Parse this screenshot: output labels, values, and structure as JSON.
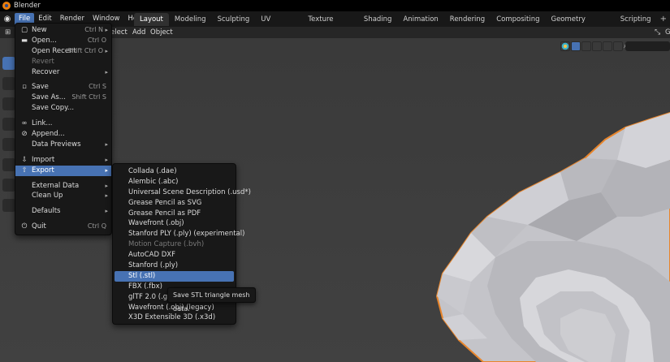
{
  "app": {
    "title": "Blender"
  },
  "topbar": {
    "menus": [
      "File",
      "Edit",
      "Render",
      "Window",
      "Help"
    ],
    "workspaces": [
      "Layout",
      "Modeling",
      "Sculpting",
      "UV Editing",
      "Texture Paint",
      "Shading",
      "Animation",
      "Rendering",
      "Compositing",
      "Geometry Nodes",
      "Scripting"
    ],
    "add_tab": "+"
  },
  "viewport_header": {
    "select_partial": "elect",
    "add": "Add",
    "object": "Object",
    "right_g": "G"
  },
  "file_menu": {
    "items": [
      {
        "label": "New",
        "shortcut": "Ctrl N",
        "icon": "document-icon",
        "glyph": "▢",
        "submenu": true
      },
      {
        "label": "Open...",
        "shortcut": "Ctrl O",
        "icon": "folder-icon",
        "glyph": "▬"
      },
      {
        "label": "Open Recent",
        "shortcut": "Shift Ctrl O",
        "submenu": true
      },
      {
        "label": "Revert",
        "disabled": true
      },
      {
        "label": "Recover",
        "submenu": true
      },
      {
        "sep": true
      },
      {
        "label": "Save",
        "shortcut": "Ctrl S",
        "icon": "save-icon",
        "glyph": "▫"
      },
      {
        "label": "Save As...",
        "shortcut": "Shift Ctrl S"
      },
      {
        "label": "Save Copy..."
      },
      {
        "sep": true
      },
      {
        "label": "Link...",
        "icon": "link-icon",
        "glyph": "∞"
      },
      {
        "label": "Append...",
        "icon": "append-icon",
        "glyph": "⊘"
      },
      {
        "label": "Data Previews",
        "submenu": true
      },
      {
        "sep": true
      },
      {
        "label": "Import",
        "icon": "import-icon",
        "glyph": "⇩",
        "submenu": true
      },
      {
        "label": "Export",
        "icon": "export-icon",
        "glyph": "⇧",
        "submenu": true,
        "highlighted": true
      },
      {
        "sep": true
      },
      {
        "label": "External Data",
        "submenu": true
      },
      {
        "label": "Clean Up",
        "submenu": true
      },
      {
        "sep": true
      },
      {
        "label": "Defaults",
        "submenu": true
      },
      {
        "sep": true
      },
      {
        "label": "Quit",
        "shortcut": "Ctrl Q",
        "icon": "power-icon",
        "glyph": "⏻"
      }
    ]
  },
  "export_menu": {
    "items": [
      {
        "label": "Collada (.dae)"
      },
      {
        "label": "Alembic (.abc)"
      },
      {
        "label": "Universal Scene Description (.usd*)"
      },
      {
        "label": "Grease Pencil as SVG"
      },
      {
        "label": "Grease Pencil as PDF"
      },
      {
        "label": "Wavefront (.obj)"
      },
      {
        "label": "Stanford PLY (.ply) (experimental)"
      },
      {
        "label": "Motion Capture (.bvh)",
        "disabled": true
      },
      {
        "label": "AutoCAD DXF"
      },
      {
        "label": "Stanford (.ply)"
      },
      {
        "label": "Stl (.stl)",
        "highlighted": true
      },
      {
        "label": "FBX (.fbx)"
      },
      {
        "label": "glTF 2.0 (.glb"
      },
      {
        "label": "Wavefront (.obj) (legacy)"
      },
      {
        "label": "X3D Extensible 3D (.x3d)"
      }
    ]
  },
  "tooltip": {
    "text": "Save STL triangle mesh data."
  },
  "colors": {
    "accent": "#4772b3",
    "menu_bg": "#181818",
    "viewport_bg": "#3d3d3d",
    "mesh_outline": "#e8852b"
  }
}
